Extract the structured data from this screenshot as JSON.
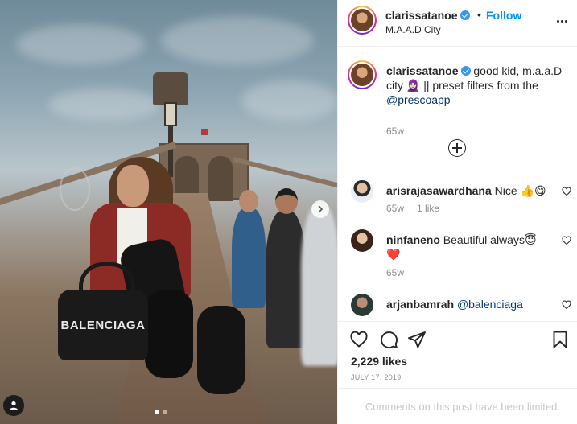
{
  "photo": {
    "bag_text": "BALENCIAGA",
    "carousel_dots": 2
  },
  "header": {
    "username": "clarissatanoe",
    "separator": "•",
    "follow_label": "Follow",
    "location": "M.A.A.D City"
  },
  "caption": {
    "username": "clarissatanoe",
    "text": "good kid, m.a.a.D city 🧕🏻 || preset filters from the ",
    "mention": "@prescoapp",
    "time": "65w"
  },
  "comments": [
    {
      "username": "arisrajasawardhana",
      "text": "Nice 👍😋",
      "time": "65w",
      "likes": "1 like"
    },
    {
      "username": "ninfaneno",
      "text": "Beautiful always😇❤️",
      "time": "65w"
    },
    {
      "username": "arjanbamrah",
      "text": "@balenciaga"
    }
  ],
  "actions": {
    "likes": "2,229 likes",
    "date": "JULY 17, 2019",
    "comments_limited": "Comments on this post have been limited."
  },
  "colors": {
    "link_blue": "#0095f6",
    "text": "#262626",
    "muted": "#8e8e8e",
    "verified": "#3897f0"
  }
}
